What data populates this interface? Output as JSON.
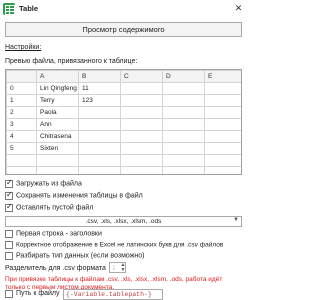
{
  "window": {
    "title": "Table",
    "close_symbol": "✕"
  },
  "preview_button": "Просмотр содержимого",
  "settings_label": "Настройки:",
  "preview_text": "Превью файла, привязанного к таблице:",
  "grid": {
    "columns": [
      "A",
      "B",
      "C",
      "D",
      "E"
    ],
    "rows": [
      {
        "num": "0",
        "cells": [
          "Lin Qingfeng",
          "11",
          "",
          "",
          ""
        ]
      },
      {
        "num": "1",
        "cells": [
          "Terry",
          "123",
          "",
          "",
          ""
        ]
      },
      {
        "num": "2",
        "cells": [
          "Paola",
          "",
          "",
          "",
          ""
        ]
      },
      {
        "num": "3",
        "cells": [
          "Ann",
          "",
          "",
          "",
          ""
        ]
      },
      {
        "num": "4",
        "cells": [
          "Chitrasena",
          "",
          "",
          "",
          ""
        ]
      },
      {
        "num": "5",
        "cells": [
          "Sixten",
          "",
          "",
          "",
          ""
        ]
      }
    ]
  },
  "options": {
    "load_from_file": {
      "label": "Загружать из файла",
      "checked": true
    },
    "save_changes": {
      "label": "Сохранять изменения таблицы в файл",
      "checked": true
    },
    "keep_empty": {
      "label": "Оставлять пустой файл",
      "checked": true
    }
  },
  "extensions": ".csv, .xls, .xlsx, .xlsm, .ods",
  "csv_options": {
    "header_row": {
      "label": "Первая строка - заголовки",
      "checked": false
    },
    "excel_latin": {
      "label": "Корректное отображение в Excel не латинских букв для .csv файлов",
      "checked": false
    },
    "parse_types": {
      "label": "Разбирать тип данных (если возможно)",
      "checked": false
    }
  },
  "delimiter": {
    "label": "Разделитель для .csv формата",
    "value": ";"
  },
  "warning": "При привязке таблицы к файлам .csv, .xls, .xlsx, .xlsm, .ods, работа идёт только с первым листом документа.",
  "path": {
    "label": "Путь к файлу",
    "value": "{-Variable.tablepath-}"
  }
}
